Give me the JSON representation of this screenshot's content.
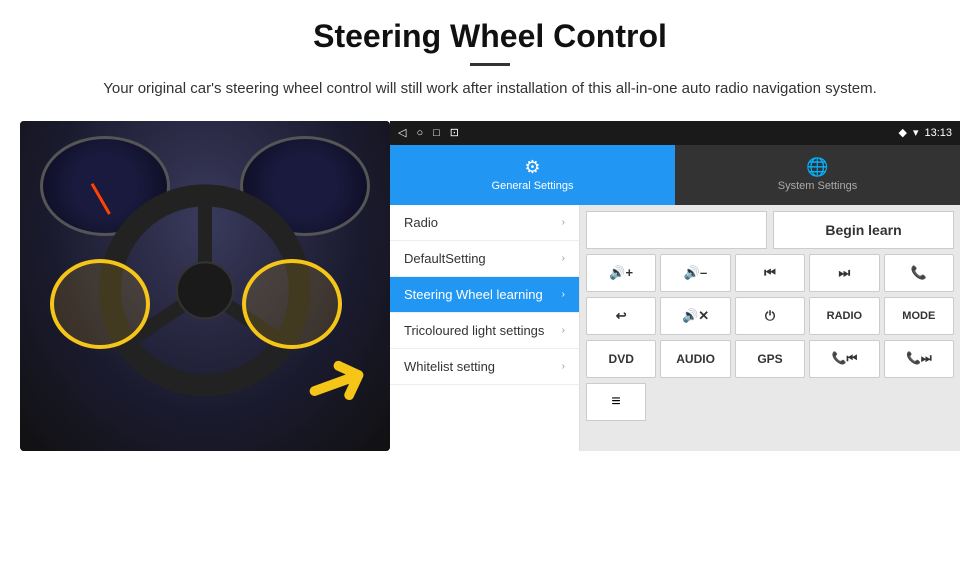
{
  "header": {
    "title": "Steering Wheel Control",
    "subtitle": "Your original car's steering wheel control will still work after installation of this all-in-one auto radio navigation system."
  },
  "status_bar": {
    "time": "13:13",
    "icons": [
      "◁",
      "○",
      "□",
      "⊡"
    ]
  },
  "tabs": [
    {
      "label": "General Settings",
      "active": true
    },
    {
      "label": "System Settings",
      "active": false
    }
  ],
  "menu": {
    "items": [
      {
        "label": "Radio",
        "active": false
      },
      {
        "label": "DefaultSetting",
        "active": false
      },
      {
        "label": "Steering Wheel learning",
        "active": true
      },
      {
        "label": "Tricoloured light settings",
        "active": false
      },
      {
        "label": "Whitelist setting",
        "active": false
      }
    ]
  },
  "right_panel": {
    "begin_learn_label": "Begin learn",
    "buttons_row1": [
      "🔊+",
      "🔊–",
      "⏮",
      "⏭",
      "📞"
    ],
    "buttons_row2": [
      "↩",
      "🔊✕",
      "⏻",
      "RADIO",
      "MODE"
    ],
    "buttons_row3_labels": [
      "DVD",
      "AUDIO",
      "GPS",
      "📞⏮",
      "📞⏭"
    ]
  },
  "arrow": "➜"
}
